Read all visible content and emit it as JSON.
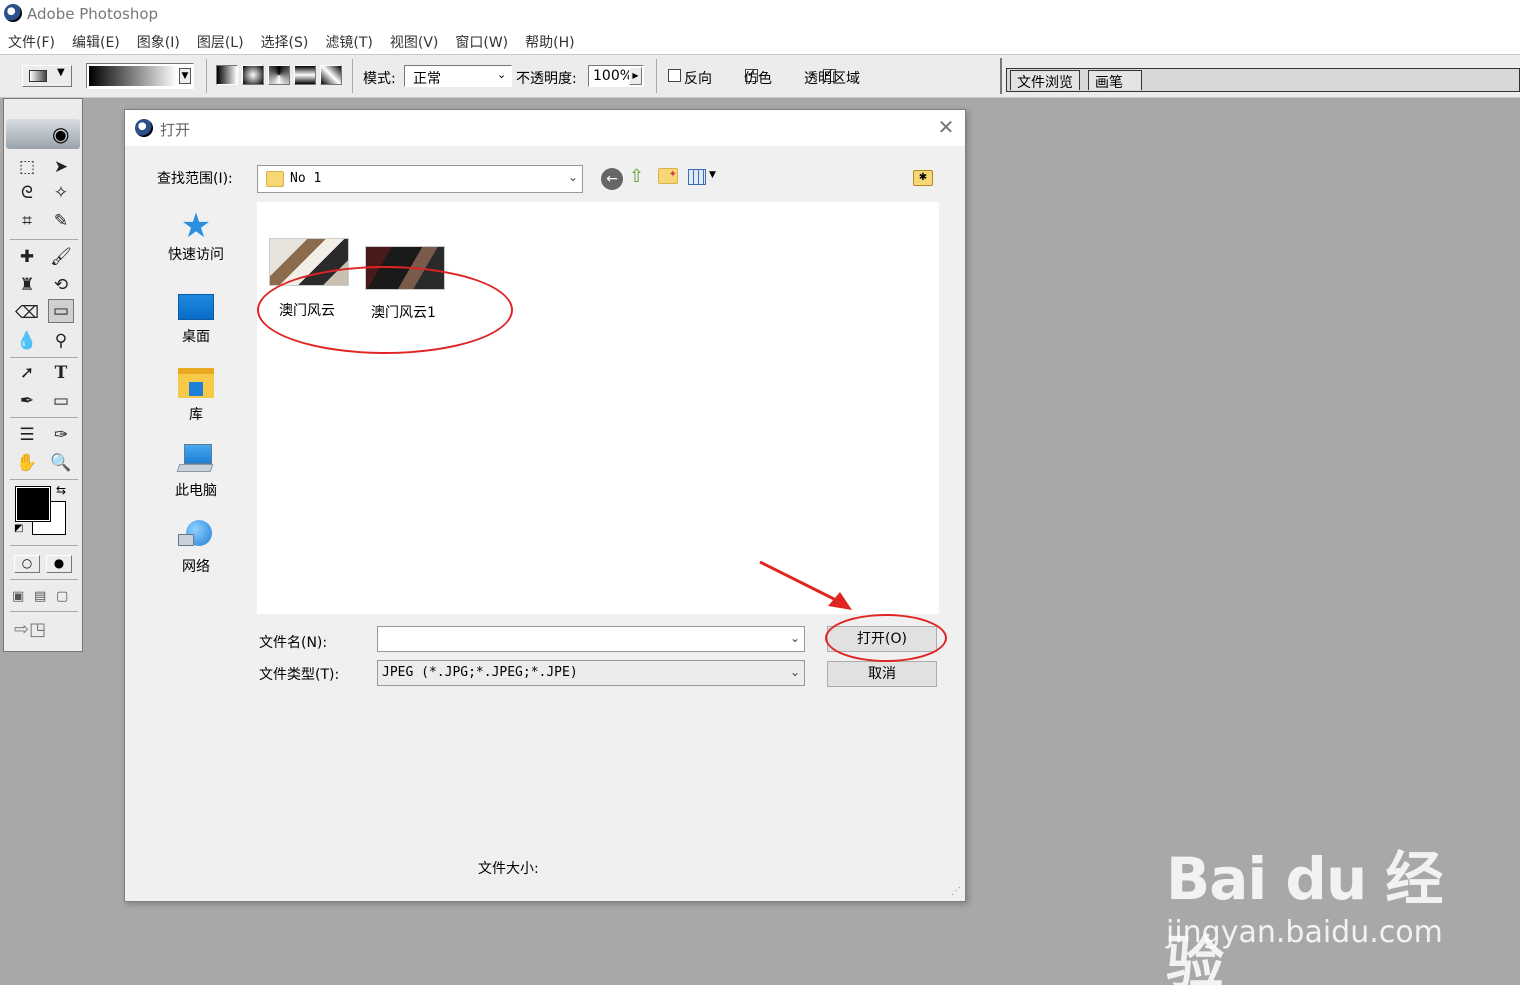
{
  "app": {
    "title": "Adobe Photoshop"
  },
  "menu": [
    "文件(F)",
    "编辑(E)",
    "图象(I)",
    "图层(L)",
    "选择(S)",
    "滤镜(T)",
    "视图(V)",
    "窗口(W)",
    "帮助(H)"
  ],
  "options": {
    "mode_label": "模式:",
    "mode_value": "正常",
    "opacity_label": "不透明度:",
    "opacity_value": "100%",
    "reverse_label": "反向",
    "reverse_checked": false,
    "dither_label": "仿色",
    "dither_checked": true,
    "transparency_label": "透明区域",
    "transparency_checked": true
  },
  "palette_tabs": [
    "文件浏览",
    "画笔"
  ],
  "dialog": {
    "title": "打开",
    "look_in_label": "查找范围(I):",
    "look_in_value": "No 1",
    "places": [
      "快速访问",
      "桌面",
      "库",
      "此电脑",
      "网络"
    ],
    "files": [
      "澳门风云",
      "澳门风云1"
    ],
    "filename_label": "文件名(N):",
    "filename_value": "",
    "filetype_label": "文件类型(T):",
    "filetype_value": "JPEG (*.JPG;*.JPEG;*.JPE)",
    "open_label": "打开(O)",
    "cancel_label": "取消",
    "filesize_label": "文件大小:"
  },
  "watermark": {
    "logo": "Bai du 经验",
    "url": "jingyan.baidu.com"
  },
  "colors": {
    "workspace": "#a8a8a8",
    "annotation": "#e02424",
    "dialog_bg": "#f0f0f0"
  }
}
